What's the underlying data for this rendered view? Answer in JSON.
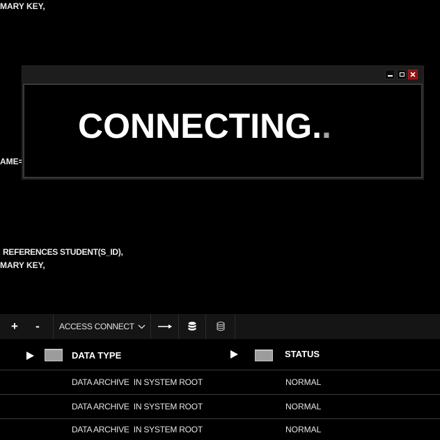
{
  "code": {
    "lines": [
      "MARY KEY,",
      "AME='",
      "REFERENCES STUDENT(S_ID),",
      "MARY KEY,"
    ]
  },
  "dialog": {
    "status_text": "CONNECTING",
    "dots": [
      ".",
      "."
    ],
    "title_buttons": [
      "minimize-icon",
      "maximize-icon",
      "close-icon"
    ]
  },
  "toolbar": {
    "add_label": "+",
    "remove_label": "-",
    "connection": {
      "selected": "ACCESS CONNECT",
      "icon": "chevron-down-icon"
    },
    "action_icons": [
      "arrow-right-icon",
      "database-icon",
      "database-outline-icon"
    ]
  },
  "table": {
    "columns": [
      {
        "label": "DATA TYPE",
        "toggle_icon": "play-triangle-icon",
        "thumb_icon": "column-thumbnail-icon"
      },
      {
        "label": "STATUS",
        "toggle_icon": "play-triangle-icon",
        "thumb_icon": "column-thumbnail-icon"
      }
    ],
    "rows": [
      {
        "type": "DATA ARCHIVE  IN SYSTEM ROOT",
        "status": "NORMAL"
      },
      {
        "type": "DATA ARCHIVE  IN SYSTEM ROOT",
        "status": "NORMAL"
      },
      {
        "type": "DATA ARCHIVE  IN SYSTEM ROOT",
        "status": "NORMAL"
      }
    ]
  },
  "colors": {
    "background": "#000000",
    "text": "#ffffff",
    "close_button": "#8b1010",
    "dot_active": "#ffffff",
    "dot_dim": "#a6a6a6"
  }
}
